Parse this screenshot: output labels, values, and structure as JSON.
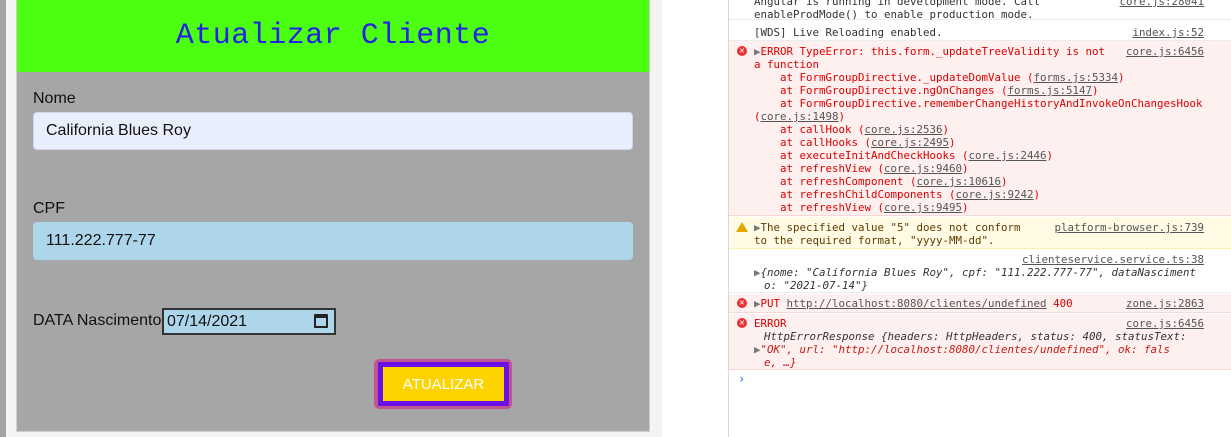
{
  "form": {
    "title": "Atualizar Cliente",
    "nome_label": "Nome",
    "nome_value": "California Blues Roy",
    "cpf_label": "CPF",
    "cpf_value": "111.222.777-77",
    "data_label": "DATA Nascimento",
    "data_value": "07/14/2021",
    "submit_label": "ATUALIZAR"
  },
  "console": {
    "line0a": "Angular is running in development mode. Call",
    "line0b": "enableProdMode() to enable production mode.",
    "line0src": "core.js:28041",
    "wds": "[WDS] Live Reloading enabled.",
    "wds_src": "index.js:52",
    "err1_a": "ERROR TypeError: this.form._updateTreeValidity is not",
    "err1_b": "a function",
    "err1_src": "core.js:6456",
    "err1_stack": [
      {
        "fn": "    at FormGroupDirective._updateDomValue (",
        "file": "forms.js:5334",
        "end": ")"
      },
      {
        "fn": "    at FormGroupDirective.ngOnChanges (",
        "file": "forms.js:5147",
        "end": ")"
      },
      {
        "fn": "    at FormGroupDirective.rememberChangeHistoryAndInvokeOnChangesHook",
        "file": "",
        "end": ""
      },
      {
        "fn": "(",
        "file": "core.js:1498",
        "end": ")"
      },
      {
        "fn": "    at callHook (",
        "file": "core.js:2536",
        "end": ")"
      },
      {
        "fn": "    at callHooks (",
        "file": "core.js:2495",
        "end": ")"
      },
      {
        "fn": "    at executeInitAndCheckHooks (",
        "file": "core.js:2446",
        "end": ")"
      },
      {
        "fn": "    at refreshView (",
        "file": "core.js:9460",
        "end": ")"
      },
      {
        "fn": "    at refreshComponent (",
        "file": "core.js:10616",
        "end": ")"
      },
      {
        "fn": "    at refreshChildComponents (",
        "file": "core.js:9242",
        "end": ")"
      },
      {
        "fn": "    at refreshView (",
        "file": "core.js:9495",
        "end": ")"
      }
    ],
    "warn_a": "The specified value \"5\" does not conform",
    "warn_b": "to the required format, \"yyyy-MM-dd\".",
    "warn_src": "platform-browser.js:739",
    "log_src": "clienteservice.service.ts:38",
    "log_obj_a": "{nome: \"California Blues Roy\", cpf: \"111.222.777-77\", dataNasciment",
    "log_obj_b": "o: \"2021-07-14\"}",
    "put_method": "PUT",
    "put_url": "http://localhost:8080/clientes/undefined",
    "put_status": "400",
    "put_src": "zone.js:2863",
    "err2_a": "ERROR",
    "err2_src": "core.js:6456",
    "err2_b": "HttpErrorResponse {headers: HttpHeaders, status: 400, statusText:",
    "err2_c": "\"OK\", url: \"http://localhost:8080/clientes/undefined\", ok: fals",
    "err2_d": "e, …}",
    "prompt": "›"
  },
  "colors": {
    "header_bg": "#4cff10",
    "title_color": "#2323e6",
    "button_bg": "#ffd300",
    "button_border": "#6a11e8",
    "error_red": "#e63232"
  }
}
